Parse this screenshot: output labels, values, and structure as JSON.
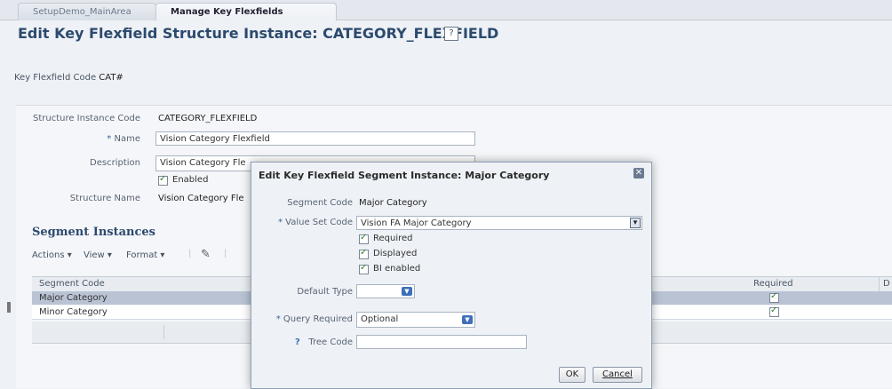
{
  "tabs": [
    {
      "label": "SetupDemo_MainArea"
    },
    {
      "label": "Manage Key Flexfields"
    }
  ],
  "header": {
    "title": "Edit Key Flexfield Structure Instance: CATEGORY_FLEXFIELD",
    "help_glyph": "?"
  },
  "kff": {
    "label": "Key Flexfield Code",
    "value": "CAT#"
  },
  "form": {
    "structure_instance_code_label": "Structure Instance Code",
    "structure_instance_code_value": "CATEGORY_FLEXFIELD",
    "name_label": "Name",
    "name_value": "Vision Category Flexfield",
    "description_label": "Description",
    "description_value": "Vision Category Fle",
    "enabled_label": "Enabled",
    "enabled_checked": true,
    "structure_name_label": "Structure Name",
    "structure_name_value": "Vision Category Fle"
  },
  "segments": {
    "title": "Segment Instances",
    "toolbar": {
      "actions": "Actions ▾",
      "view": "View ▾",
      "format": "Format ▾"
    },
    "columns": [
      "Segment Code",
      "Required",
      "D"
    ],
    "rows": [
      {
        "segment_code": "Major Category",
        "required": true
      },
      {
        "segment_code": "Minor Category",
        "required": true
      }
    ]
  },
  "dialog": {
    "title": "Edit Key Flexfield Segment Instance: Major Category",
    "close_glyph": "✕",
    "segment_code_label": "Segment Code",
    "segment_code_value": "Major Category",
    "value_set_code_label": "Value Set Code",
    "value_set_code_value": "Vision FA Major Category",
    "required_label": "Required",
    "displayed_label": "Displayed",
    "bi_enabled_label": "BI enabled",
    "default_type_label": "Default Type",
    "default_type_value": "",
    "query_required_label": "Query Required",
    "query_required_value": "Optional",
    "tree_code_label": "Tree Code",
    "tree_code_value": "",
    "ok_label": "OK",
    "cancel_label": "Cancel"
  },
  "colors": {
    "title_blue": "#2c4a6e",
    "selected_row": "#b9c3d3",
    "dialog_bg": "#eef2f7"
  }
}
